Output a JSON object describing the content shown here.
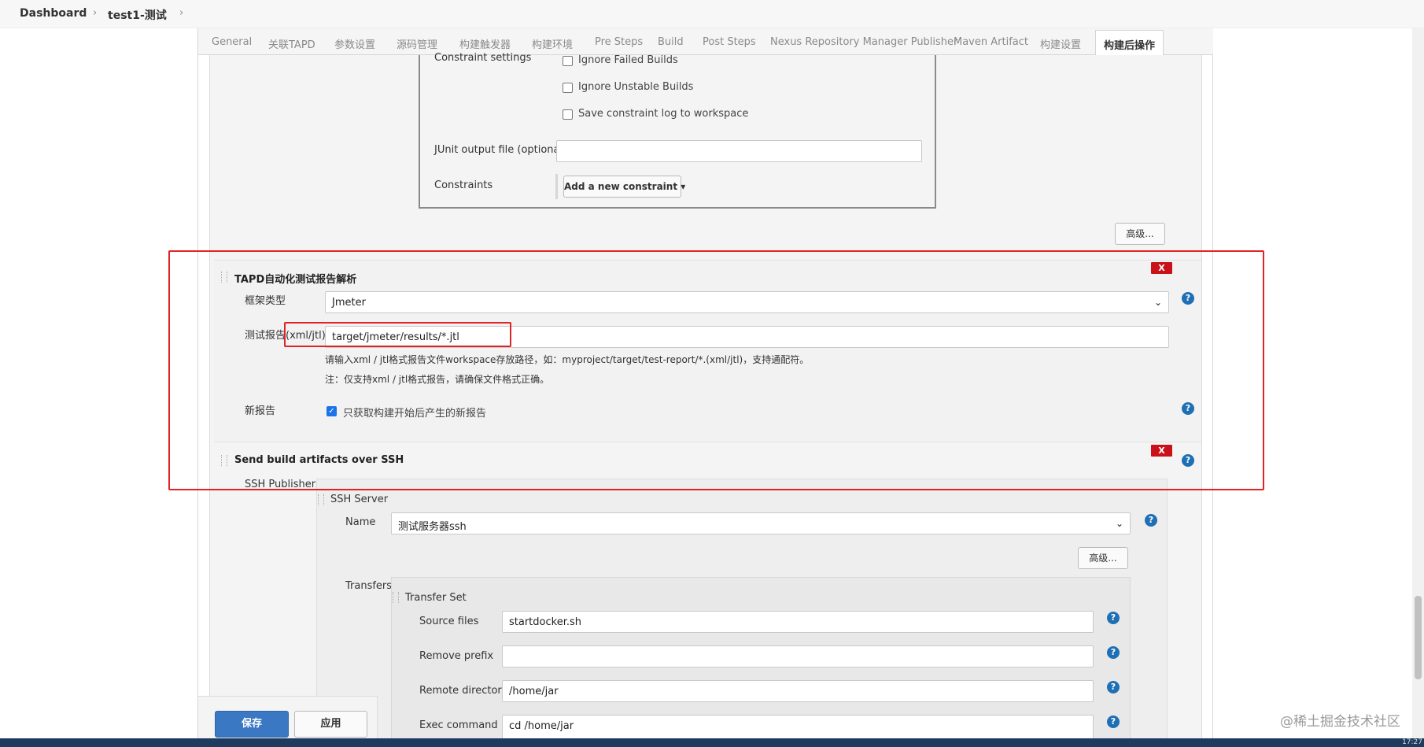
{
  "breadcrumb": {
    "items": [
      {
        "label": "Dashboard"
      },
      {
        "label": "test1-测试"
      }
    ]
  },
  "tabs": [
    {
      "label": "General"
    },
    {
      "label": "关联TAPD"
    },
    {
      "label": "参数设置"
    },
    {
      "label": "源码管理"
    },
    {
      "label": "构建触发器"
    },
    {
      "label": "构建环境"
    },
    {
      "label": "Pre Steps"
    },
    {
      "label": "Build"
    },
    {
      "label": "Post Steps"
    },
    {
      "label": "Nexus Repository Manager Publisher"
    },
    {
      "label": "Maven Artifact"
    },
    {
      "label": "构建设置"
    },
    {
      "label": "构建后操作",
      "active": true
    }
  ],
  "constraint_panel": {
    "settings_label": "Constraint settings",
    "options": [
      {
        "label": "Ignore Failed Builds",
        "checked": false
      },
      {
        "label": "Ignore Unstable Builds",
        "checked": false
      },
      {
        "label": "Save constraint log to workspace",
        "checked": false
      }
    ],
    "junit_label": "JUnit output file (optional)",
    "junit_value": "",
    "constraints_label": "Constraints",
    "add_constraint_label": "Add a new constraint"
  },
  "advanced_label": "高级...",
  "tapd_section": {
    "title": "TAPD自动化测试报告解析",
    "delete_label": "X",
    "framework_label": "框架类型",
    "framework_value": "Jmeter",
    "report_label": "测试报告(xml/jtl)",
    "report_value": "target/jmeter/results/*.jtl",
    "hint1": "请输入xml / jtl格式报告文件workspace存放路径，如：myproject/target/test-report/*.(xml/jtl)，支持通配符。",
    "hint2": "注：仅支持xml / jtl格式报告，请确保文件格式正确。",
    "new_report_label": "新报告",
    "new_report_checkbox_label": "只获取构建开始后产生的新报告",
    "new_report_checked": true
  },
  "ssh_section": {
    "title": "Send build artifacts over SSH",
    "delete_label": "X",
    "publishers_label": "SSH Publishers",
    "server_label": "SSH Server",
    "name_label": "Name",
    "name_value": "测试服务器ssh",
    "advanced_label": "高级...",
    "transfers_label": "Transfers",
    "transfer_set_label": "Transfer Set",
    "source_files_label": "Source files",
    "source_files_value": "startdocker.sh",
    "remove_prefix_label": "Remove prefix",
    "remove_prefix_value": "",
    "remote_directory_label": "Remote directory",
    "remote_directory_value": "/home/jar",
    "exec_command_label": "Exec command",
    "exec_command_value": "cd /home/jar"
  },
  "footer": {
    "save_label": "保存",
    "apply_label": "应用"
  },
  "watermark": "@稀土掘金技术社区",
  "clock": "17:27",
  "colors": {
    "primary_button": "#3a78c3",
    "delete_button": "#c9111a",
    "help_icon": "#1f6fb5",
    "highlight_box": "#e02424"
  }
}
